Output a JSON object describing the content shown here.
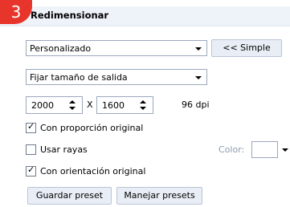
{
  "step_number": "3",
  "section_title": "Redimensionar",
  "mode_select": {
    "value": "Personalizado"
  },
  "simple_button": "<< Simple",
  "size_select": {
    "value": "Fijar tamaño de salida"
  },
  "width": {
    "value": "2000"
  },
  "separator": "X",
  "height": {
    "value": "1600"
  },
  "dpi": "96 dpi",
  "keep_ratio": {
    "label": "Con proporción original",
    "checked": true,
    "mark": "✓"
  },
  "use_stripes": {
    "label": "Usar rayas",
    "checked": false,
    "mark": ""
  },
  "color_label": "Color:",
  "keep_orientation": {
    "label": "Con orientación original",
    "checked": true,
    "mark": "✓"
  },
  "save_preset": "Guardar preset",
  "manage_presets": "Manejar presets"
}
